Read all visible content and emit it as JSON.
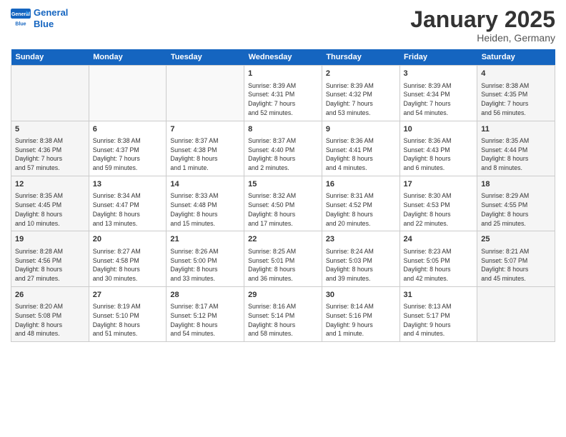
{
  "header": {
    "logo_line1": "General",
    "logo_line2": "Blue",
    "month_title": "January 2025",
    "location": "Heiden, Germany"
  },
  "days_of_week": [
    "Sunday",
    "Monday",
    "Tuesday",
    "Wednesday",
    "Thursday",
    "Friday",
    "Saturday"
  ],
  "weeks": [
    [
      {
        "day": "",
        "content": ""
      },
      {
        "day": "",
        "content": ""
      },
      {
        "day": "",
        "content": ""
      },
      {
        "day": "1",
        "content": "Sunrise: 8:39 AM\nSunset: 4:31 PM\nDaylight: 7 hours\nand 52 minutes."
      },
      {
        "day": "2",
        "content": "Sunrise: 8:39 AM\nSunset: 4:32 PM\nDaylight: 7 hours\nand 53 minutes."
      },
      {
        "day": "3",
        "content": "Sunrise: 8:39 AM\nSunset: 4:34 PM\nDaylight: 7 hours\nand 54 minutes."
      },
      {
        "day": "4",
        "content": "Sunrise: 8:38 AM\nSunset: 4:35 PM\nDaylight: 7 hours\nand 56 minutes."
      }
    ],
    [
      {
        "day": "5",
        "content": "Sunrise: 8:38 AM\nSunset: 4:36 PM\nDaylight: 7 hours\nand 57 minutes."
      },
      {
        "day": "6",
        "content": "Sunrise: 8:38 AM\nSunset: 4:37 PM\nDaylight: 7 hours\nand 59 minutes."
      },
      {
        "day": "7",
        "content": "Sunrise: 8:37 AM\nSunset: 4:38 PM\nDaylight: 8 hours\nand 1 minute."
      },
      {
        "day": "8",
        "content": "Sunrise: 8:37 AM\nSunset: 4:40 PM\nDaylight: 8 hours\nand 2 minutes."
      },
      {
        "day": "9",
        "content": "Sunrise: 8:36 AM\nSunset: 4:41 PM\nDaylight: 8 hours\nand 4 minutes."
      },
      {
        "day": "10",
        "content": "Sunrise: 8:36 AM\nSunset: 4:43 PM\nDaylight: 8 hours\nand 6 minutes."
      },
      {
        "day": "11",
        "content": "Sunrise: 8:35 AM\nSunset: 4:44 PM\nDaylight: 8 hours\nand 8 minutes."
      }
    ],
    [
      {
        "day": "12",
        "content": "Sunrise: 8:35 AM\nSunset: 4:45 PM\nDaylight: 8 hours\nand 10 minutes."
      },
      {
        "day": "13",
        "content": "Sunrise: 8:34 AM\nSunset: 4:47 PM\nDaylight: 8 hours\nand 13 minutes."
      },
      {
        "day": "14",
        "content": "Sunrise: 8:33 AM\nSunset: 4:48 PM\nDaylight: 8 hours\nand 15 minutes."
      },
      {
        "day": "15",
        "content": "Sunrise: 8:32 AM\nSunset: 4:50 PM\nDaylight: 8 hours\nand 17 minutes."
      },
      {
        "day": "16",
        "content": "Sunrise: 8:31 AM\nSunset: 4:52 PM\nDaylight: 8 hours\nand 20 minutes."
      },
      {
        "day": "17",
        "content": "Sunrise: 8:30 AM\nSunset: 4:53 PM\nDaylight: 8 hours\nand 22 minutes."
      },
      {
        "day": "18",
        "content": "Sunrise: 8:29 AM\nSunset: 4:55 PM\nDaylight: 8 hours\nand 25 minutes."
      }
    ],
    [
      {
        "day": "19",
        "content": "Sunrise: 8:28 AM\nSunset: 4:56 PM\nDaylight: 8 hours\nand 27 minutes."
      },
      {
        "day": "20",
        "content": "Sunrise: 8:27 AM\nSunset: 4:58 PM\nDaylight: 8 hours\nand 30 minutes."
      },
      {
        "day": "21",
        "content": "Sunrise: 8:26 AM\nSunset: 5:00 PM\nDaylight: 8 hours\nand 33 minutes."
      },
      {
        "day": "22",
        "content": "Sunrise: 8:25 AM\nSunset: 5:01 PM\nDaylight: 8 hours\nand 36 minutes."
      },
      {
        "day": "23",
        "content": "Sunrise: 8:24 AM\nSunset: 5:03 PM\nDaylight: 8 hours\nand 39 minutes."
      },
      {
        "day": "24",
        "content": "Sunrise: 8:23 AM\nSunset: 5:05 PM\nDaylight: 8 hours\nand 42 minutes."
      },
      {
        "day": "25",
        "content": "Sunrise: 8:21 AM\nSunset: 5:07 PM\nDaylight: 8 hours\nand 45 minutes."
      }
    ],
    [
      {
        "day": "26",
        "content": "Sunrise: 8:20 AM\nSunset: 5:08 PM\nDaylight: 8 hours\nand 48 minutes."
      },
      {
        "day": "27",
        "content": "Sunrise: 8:19 AM\nSunset: 5:10 PM\nDaylight: 8 hours\nand 51 minutes."
      },
      {
        "day": "28",
        "content": "Sunrise: 8:17 AM\nSunset: 5:12 PM\nDaylight: 8 hours\nand 54 minutes."
      },
      {
        "day": "29",
        "content": "Sunrise: 8:16 AM\nSunset: 5:14 PM\nDaylight: 8 hours\nand 58 minutes."
      },
      {
        "day": "30",
        "content": "Sunrise: 8:14 AM\nSunset: 5:16 PM\nDaylight: 9 hours\nand 1 minute."
      },
      {
        "day": "31",
        "content": "Sunrise: 8:13 AM\nSunset: 5:17 PM\nDaylight: 9 hours\nand 4 minutes."
      },
      {
        "day": "",
        "content": ""
      }
    ]
  ]
}
